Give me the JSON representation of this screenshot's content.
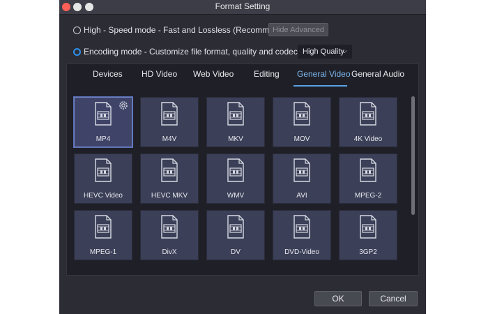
{
  "window": {
    "title": "Format Setting"
  },
  "options": {
    "high_speed": {
      "label": "High - Speed mode - Fast and Lossless (Recommended)",
      "selected": false
    },
    "encoding": {
      "label": "Encoding mode - Customize file format, quality and codec (Slow)",
      "selected": true
    }
  },
  "hide_advanced_label": "Hide Advanced",
  "quality": {
    "value": "High Quality",
    "chevron": "⌵"
  },
  "tabs": [
    {
      "label": "Devices"
    },
    {
      "label": "HD Video"
    },
    {
      "label": "Web Video"
    },
    {
      "label": "Editing"
    },
    {
      "label": "General Video",
      "active": true
    },
    {
      "label": "General Audio"
    }
  ],
  "formats": [
    "MP4",
    "M4V",
    "MKV",
    "MOV",
    "4K Video",
    "HEVC Video",
    "HEVC MKV",
    "WMV",
    "AVI",
    "MPEG-2",
    "MPEG-1",
    "DivX",
    "DV",
    "DVD-Video",
    "3GP2"
  ],
  "selected_format": "MP4",
  "footer": {
    "ok_label": "OK",
    "cancel_label": "Cancel"
  },
  "colors": {
    "accent": "#5aa2e6",
    "tile": "#3b3f57",
    "panel": "#1f2027"
  }
}
